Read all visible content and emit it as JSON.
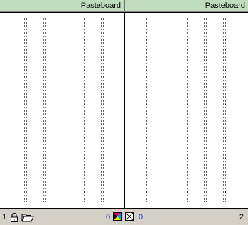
{
  "left_page": {
    "header": "Pasteboard",
    "page_number": "1"
  },
  "right_page": {
    "header": "Pasteboard",
    "page_number": "2"
  },
  "status": {
    "count_a": "0",
    "count_b": "0"
  },
  "icons": {
    "lock": "lock-icon",
    "folder": "folder-open-icon",
    "color_swatch": "cmyk-swatch-icon",
    "none_swatch": "none-swatch-icon"
  },
  "colors": {
    "header_bg": "#bfdcbe",
    "count_text": "#1a3fd1",
    "chrome_bg": "#d4d0c8"
  }
}
